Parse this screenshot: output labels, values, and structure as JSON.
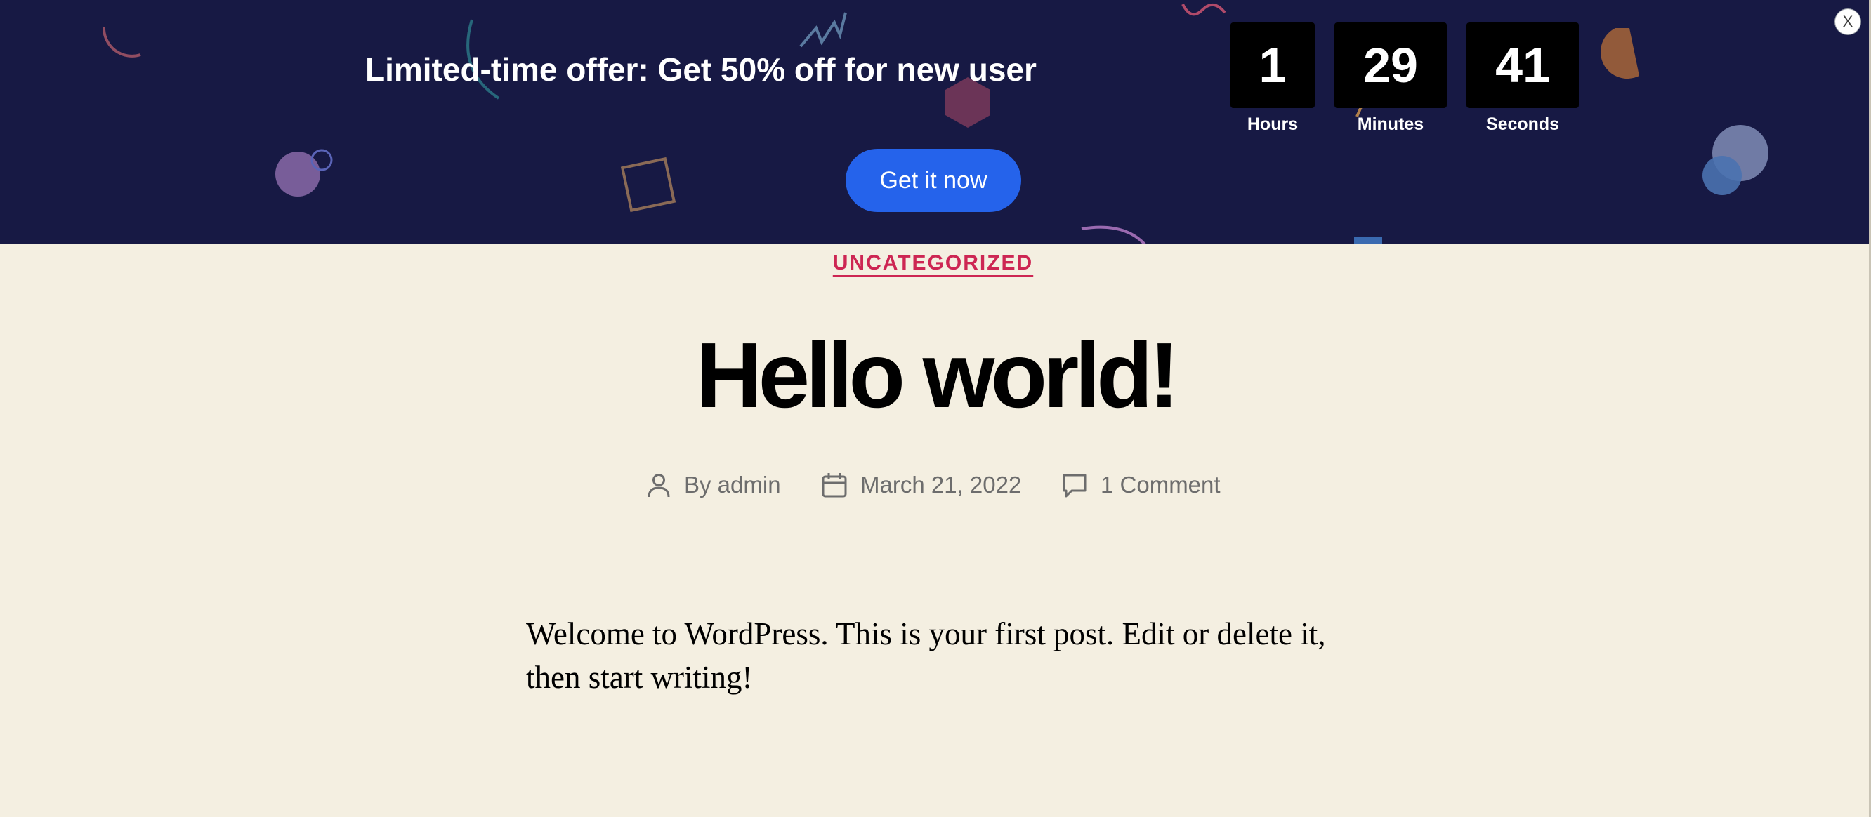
{
  "promo": {
    "headline": "Limited-time offer: Get 50% off for new user",
    "countdown": [
      {
        "value": "1",
        "unit": "Hours"
      },
      {
        "value": "29",
        "unit": "Minutes"
      },
      {
        "value": "41",
        "unit": "Seconds"
      }
    ],
    "cta_label": "Get it now",
    "close_label": "X",
    "colors": {
      "background": "#171944",
      "cta": "#2563eb",
      "countdown_box": "#000000"
    }
  },
  "post": {
    "category": "UNCATEGORIZED",
    "title": "Hello world!",
    "meta": {
      "author": "By admin",
      "date": "March 21, 2022",
      "comments": "1 Comment"
    },
    "content": "Welcome to WordPress. This is your first post. Edit or delete it, then start writing!"
  },
  "icons": {
    "author": "user-icon",
    "date": "calendar-icon",
    "comments": "comment-bubble-icon",
    "close": "close-icon"
  },
  "colors": {
    "page_background": "#f4efe1",
    "category": "#cd2653",
    "meta_text": "#6d6d6d"
  }
}
